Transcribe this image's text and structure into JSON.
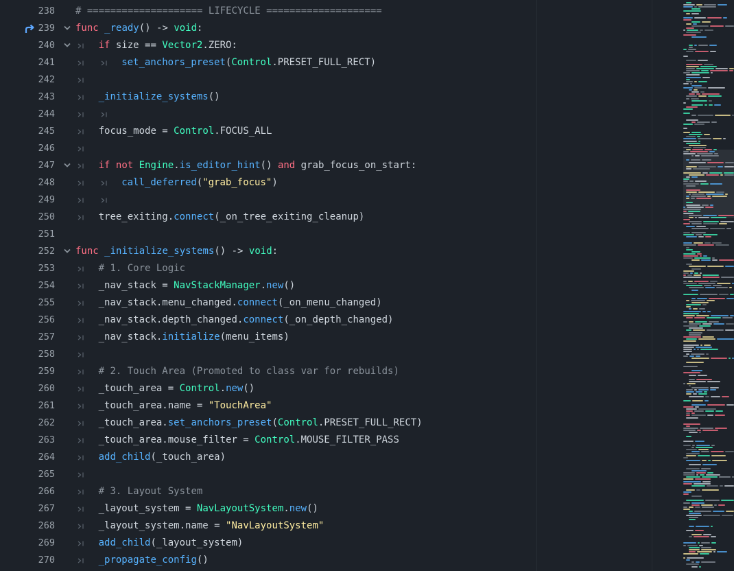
{
  "colors": {
    "background": "#1d2229",
    "line_number": "#9ba3ab",
    "text": "#cfd6dd",
    "comment": "#8b939c",
    "keyword": "#ff7085",
    "type": "#42ffc2",
    "function": "#57b3ff",
    "string": "#ffeda1",
    "tab_marker": "#5a636d",
    "override_icon": "#5ea8ff"
  },
  "editor": {
    "lines": [
      {
        "number": "238",
        "tabs": 0,
        "fold": false,
        "override": false,
        "tokens": [
          {
            "t": "# ==================== LIFECYCLE ====================",
            "c": "comment"
          }
        ]
      },
      {
        "number": "239",
        "tabs": 0,
        "fold": true,
        "override": true,
        "tokens": [
          {
            "t": "func",
            "c": "keyword"
          },
          {
            "t": " ",
            "c": "text"
          },
          {
            "t": "_ready",
            "c": "function"
          },
          {
            "t": "() ",
            "c": "text"
          },
          {
            "t": "->",
            "c": "text"
          },
          {
            "t": " ",
            "c": "text"
          },
          {
            "t": "void",
            "c": "type"
          },
          {
            "t": ":",
            "c": "text"
          }
        ]
      },
      {
        "number": "240",
        "tabs": 1,
        "fold": true,
        "override": false,
        "tokens": [
          {
            "t": "if",
            "c": "keyword"
          },
          {
            "t": " size ",
            "c": "text"
          },
          {
            "t": "==",
            "c": "text"
          },
          {
            "t": " ",
            "c": "text"
          },
          {
            "t": "Vector2",
            "c": "type"
          },
          {
            "t": ".ZERO:",
            "c": "text"
          }
        ]
      },
      {
        "number": "241",
        "tabs": 2,
        "fold": false,
        "override": false,
        "tokens": [
          {
            "t": "set_anchors_preset",
            "c": "function"
          },
          {
            "t": "(",
            "c": "text"
          },
          {
            "t": "Control",
            "c": "type"
          },
          {
            "t": ".PRESET_FULL_RECT)",
            "c": "text"
          }
        ]
      },
      {
        "number": "242",
        "tabs": 1,
        "fold": false,
        "override": false,
        "tokens": []
      },
      {
        "number": "243",
        "tabs": 1,
        "fold": false,
        "override": false,
        "tokens": [
          {
            "t": "_initialize_systems",
            "c": "function"
          },
          {
            "t": "()",
            "c": "text"
          }
        ]
      },
      {
        "number": "244",
        "tabs": 2,
        "fold": false,
        "override": false,
        "tokens": []
      },
      {
        "number": "245",
        "tabs": 1,
        "fold": false,
        "override": false,
        "tokens": [
          {
            "t": "focus_mode = ",
            "c": "text"
          },
          {
            "t": "Control",
            "c": "type"
          },
          {
            "t": ".FOCUS_ALL",
            "c": "text"
          }
        ]
      },
      {
        "number": "246",
        "tabs": 1,
        "fold": false,
        "override": false,
        "tokens": []
      },
      {
        "number": "247",
        "tabs": 1,
        "fold": true,
        "override": false,
        "tokens": [
          {
            "t": "if",
            "c": "keyword"
          },
          {
            "t": " ",
            "c": "text"
          },
          {
            "t": "not",
            "c": "keyword"
          },
          {
            "t": " ",
            "c": "text"
          },
          {
            "t": "Engine",
            "c": "type"
          },
          {
            "t": ".",
            "c": "text"
          },
          {
            "t": "is_editor_hint",
            "c": "function"
          },
          {
            "t": "() ",
            "c": "text"
          },
          {
            "t": "and",
            "c": "keyword"
          },
          {
            "t": " grab_focus_on_start:",
            "c": "text"
          }
        ]
      },
      {
        "number": "248",
        "tabs": 2,
        "fold": false,
        "override": false,
        "tokens": [
          {
            "t": "call_deferred",
            "c": "function"
          },
          {
            "t": "(",
            "c": "text"
          },
          {
            "t": "\"grab_focus\"",
            "c": "string"
          },
          {
            "t": ")",
            "c": "text"
          }
        ]
      },
      {
        "number": "249",
        "tabs": 2,
        "fold": false,
        "override": false,
        "tokens": []
      },
      {
        "number": "250",
        "tabs": 1,
        "fold": false,
        "override": false,
        "tokens": [
          {
            "t": "tree_exiting.",
            "c": "text"
          },
          {
            "t": "connect",
            "c": "function"
          },
          {
            "t": "(_on_tree_exiting_cleanup)",
            "c": "text"
          }
        ]
      },
      {
        "number": "251",
        "tabs": 0,
        "fold": false,
        "override": false,
        "tokens": []
      },
      {
        "number": "252",
        "tabs": 0,
        "fold": true,
        "override": false,
        "tokens": [
          {
            "t": "func",
            "c": "keyword"
          },
          {
            "t": " ",
            "c": "text"
          },
          {
            "t": "_initialize_systems",
            "c": "function"
          },
          {
            "t": "() ",
            "c": "text"
          },
          {
            "t": "->",
            "c": "text"
          },
          {
            "t": " ",
            "c": "text"
          },
          {
            "t": "void",
            "c": "type"
          },
          {
            "t": ":",
            "c": "text"
          }
        ]
      },
      {
        "number": "253",
        "tabs": 1,
        "fold": false,
        "override": false,
        "tokens": [
          {
            "t": "# 1. Core Logic",
            "c": "comment"
          }
        ]
      },
      {
        "number": "254",
        "tabs": 1,
        "fold": false,
        "override": false,
        "tokens": [
          {
            "t": "_nav_stack = ",
            "c": "text"
          },
          {
            "t": "NavStackManager",
            "c": "type"
          },
          {
            "t": ".",
            "c": "text"
          },
          {
            "t": "new",
            "c": "function"
          },
          {
            "t": "()",
            "c": "text"
          }
        ]
      },
      {
        "number": "255",
        "tabs": 1,
        "fold": false,
        "override": false,
        "tokens": [
          {
            "t": "_nav_stack.menu_changed.",
            "c": "text"
          },
          {
            "t": "connect",
            "c": "function"
          },
          {
            "t": "(_on_menu_changed)",
            "c": "text"
          }
        ]
      },
      {
        "number": "256",
        "tabs": 1,
        "fold": false,
        "override": false,
        "tokens": [
          {
            "t": "_nav_stack.depth_changed.",
            "c": "text"
          },
          {
            "t": "connect",
            "c": "function"
          },
          {
            "t": "(_on_depth_changed)",
            "c": "text"
          }
        ]
      },
      {
        "number": "257",
        "tabs": 1,
        "fold": false,
        "override": false,
        "tokens": [
          {
            "t": "_nav_stack.",
            "c": "text"
          },
          {
            "t": "initialize",
            "c": "function"
          },
          {
            "t": "(menu_items)",
            "c": "text"
          }
        ]
      },
      {
        "number": "258",
        "tabs": 1,
        "fold": false,
        "override": false,
        "tokens": []
      },
      {
        "number": "259",
        "tabs": 1,
        "fold": false,
        "override": false,
        "tokens": [
          {
            "t": "# 2. Touch Area (Promoted to class var for rebuilds)",
            "c": "comment"
          }
        ]
      },
      {
        "number": "260",
        "tabs": 1,
        "fold": false,
        "override": false,
        "tokens": [
          {
            "t": "_touch_area = ",
            "c": "text"
          },
          {
            "t": "Control",
            "c": "type"
          },
          {
            "t": ".",
            "c": "text"
          },
          {
            "t": "new",
            "c": "function"
          },
          {
            "t": "()",
            "c": "text"
          }
        ]
      },
      {
        "number": "261",
        "tabs": 1,
        "fold": false,
        "override": false,
        "tokens": [
          {
            "t": "_touch_area.name = ",
            "c": "text"
          },
          {
            "t": "\"TouchArea\"",
            "c": "string"
          }
        ]
      },
      {
        "number": "262",
        "tabs": 1,
        "fold": false,
        "override": false,
        "tokens": [
          {
            "t": "_touch_area.",
            "c": "text"
          },
          {
            "t": "set_anchors_preset",
            "c": "function"
          },
          {
            "t": "(",
            "c": "text"
          },
          {
            "t": "Control",
            "c": "type"
          },
          {
            "t": ".PRESET_FULL_RECT)",
            "c": "text"
          }
        ]
      },
      {
        "number": "263",
        "tabs": 1,
        "fold": false,
        "override": false,
        "tokens": [
          {
            "t": "_touch_area.mouse_filter = ",
            "c": "text"
          },
          {
            "t": "Control",
            "c": "type"
          },
          {
            "t": ".MOUSE_FILTER_PASS",
            "c": "text"
          }
        ]
      },
      {
        "number": "264",
        "tabs": 1,
        "fold": false,
        "override": false,
        "tokens": [
          {
            "t": "add_child",
            "c": "function"
          },
          {
            "t": "(_touch_area)",
            "c": "text"
          }
        ]
      },
      {
        "number": "265",
        "tabs": 1,
        "fold": false,
        "override": false,
        "tokens": []
      },
      {
        "number": "266",
        "tabs": 1,
        "fold": false,
        "override": false,
        "tokens": [
          {
            "t": "# 3. Layout System",
            "c": "comment"
          }
        ]
      },
      {
        "number": "267",
        "tabs": 1,
        "fold": false,
        "override": false,
        "tokens": [
          {
            "t": "_layout_system = ",
            "c": "text"
          },
          {
            "t": "NavLayoutSystem",
            "c": "type"
          },
          {
            "t": ".",
            "c": "text"
          },
          {
            "t": "new",
            "c": "function"
          },
          {
            "t": "()",
            "c": "text"
          }
        ]
      },
      {
        "number": "268",
        "tabs": 1,
        "fold": false,
        "override": false,
        "tokens": [
          {
            "t": "_layout_system.name = ",
            "c": "text"
          },
          {
            "t": "\"NavLayoutSystem\"",
            "c": "string"
          }
        ]
      },
      {
        "number": "269",
        "tabs": 1,
        "fold": false,
        "override": false,
        "tokens": [
          {
            "t": "add_child",
            "c": "function"
          },
          {
            "t": "(_layout_system)",
            "c": "text"
          }
        ]
      },
      {
        "number": "270",
        "tabs": 1,
        "fold": false,
        "override": false,
        "tokens": [
          {
            "t": "_propagate_config",
            "c": "function"
          },
          {
            "t": "()",
            "c": "text"
          }
        ]
      }
    ]
  },
  "icons": {
    "fold": "chevron-down-icon",
    "tab": "tab-marker-icon",
    "override": "override-method-icon"
  }
}
